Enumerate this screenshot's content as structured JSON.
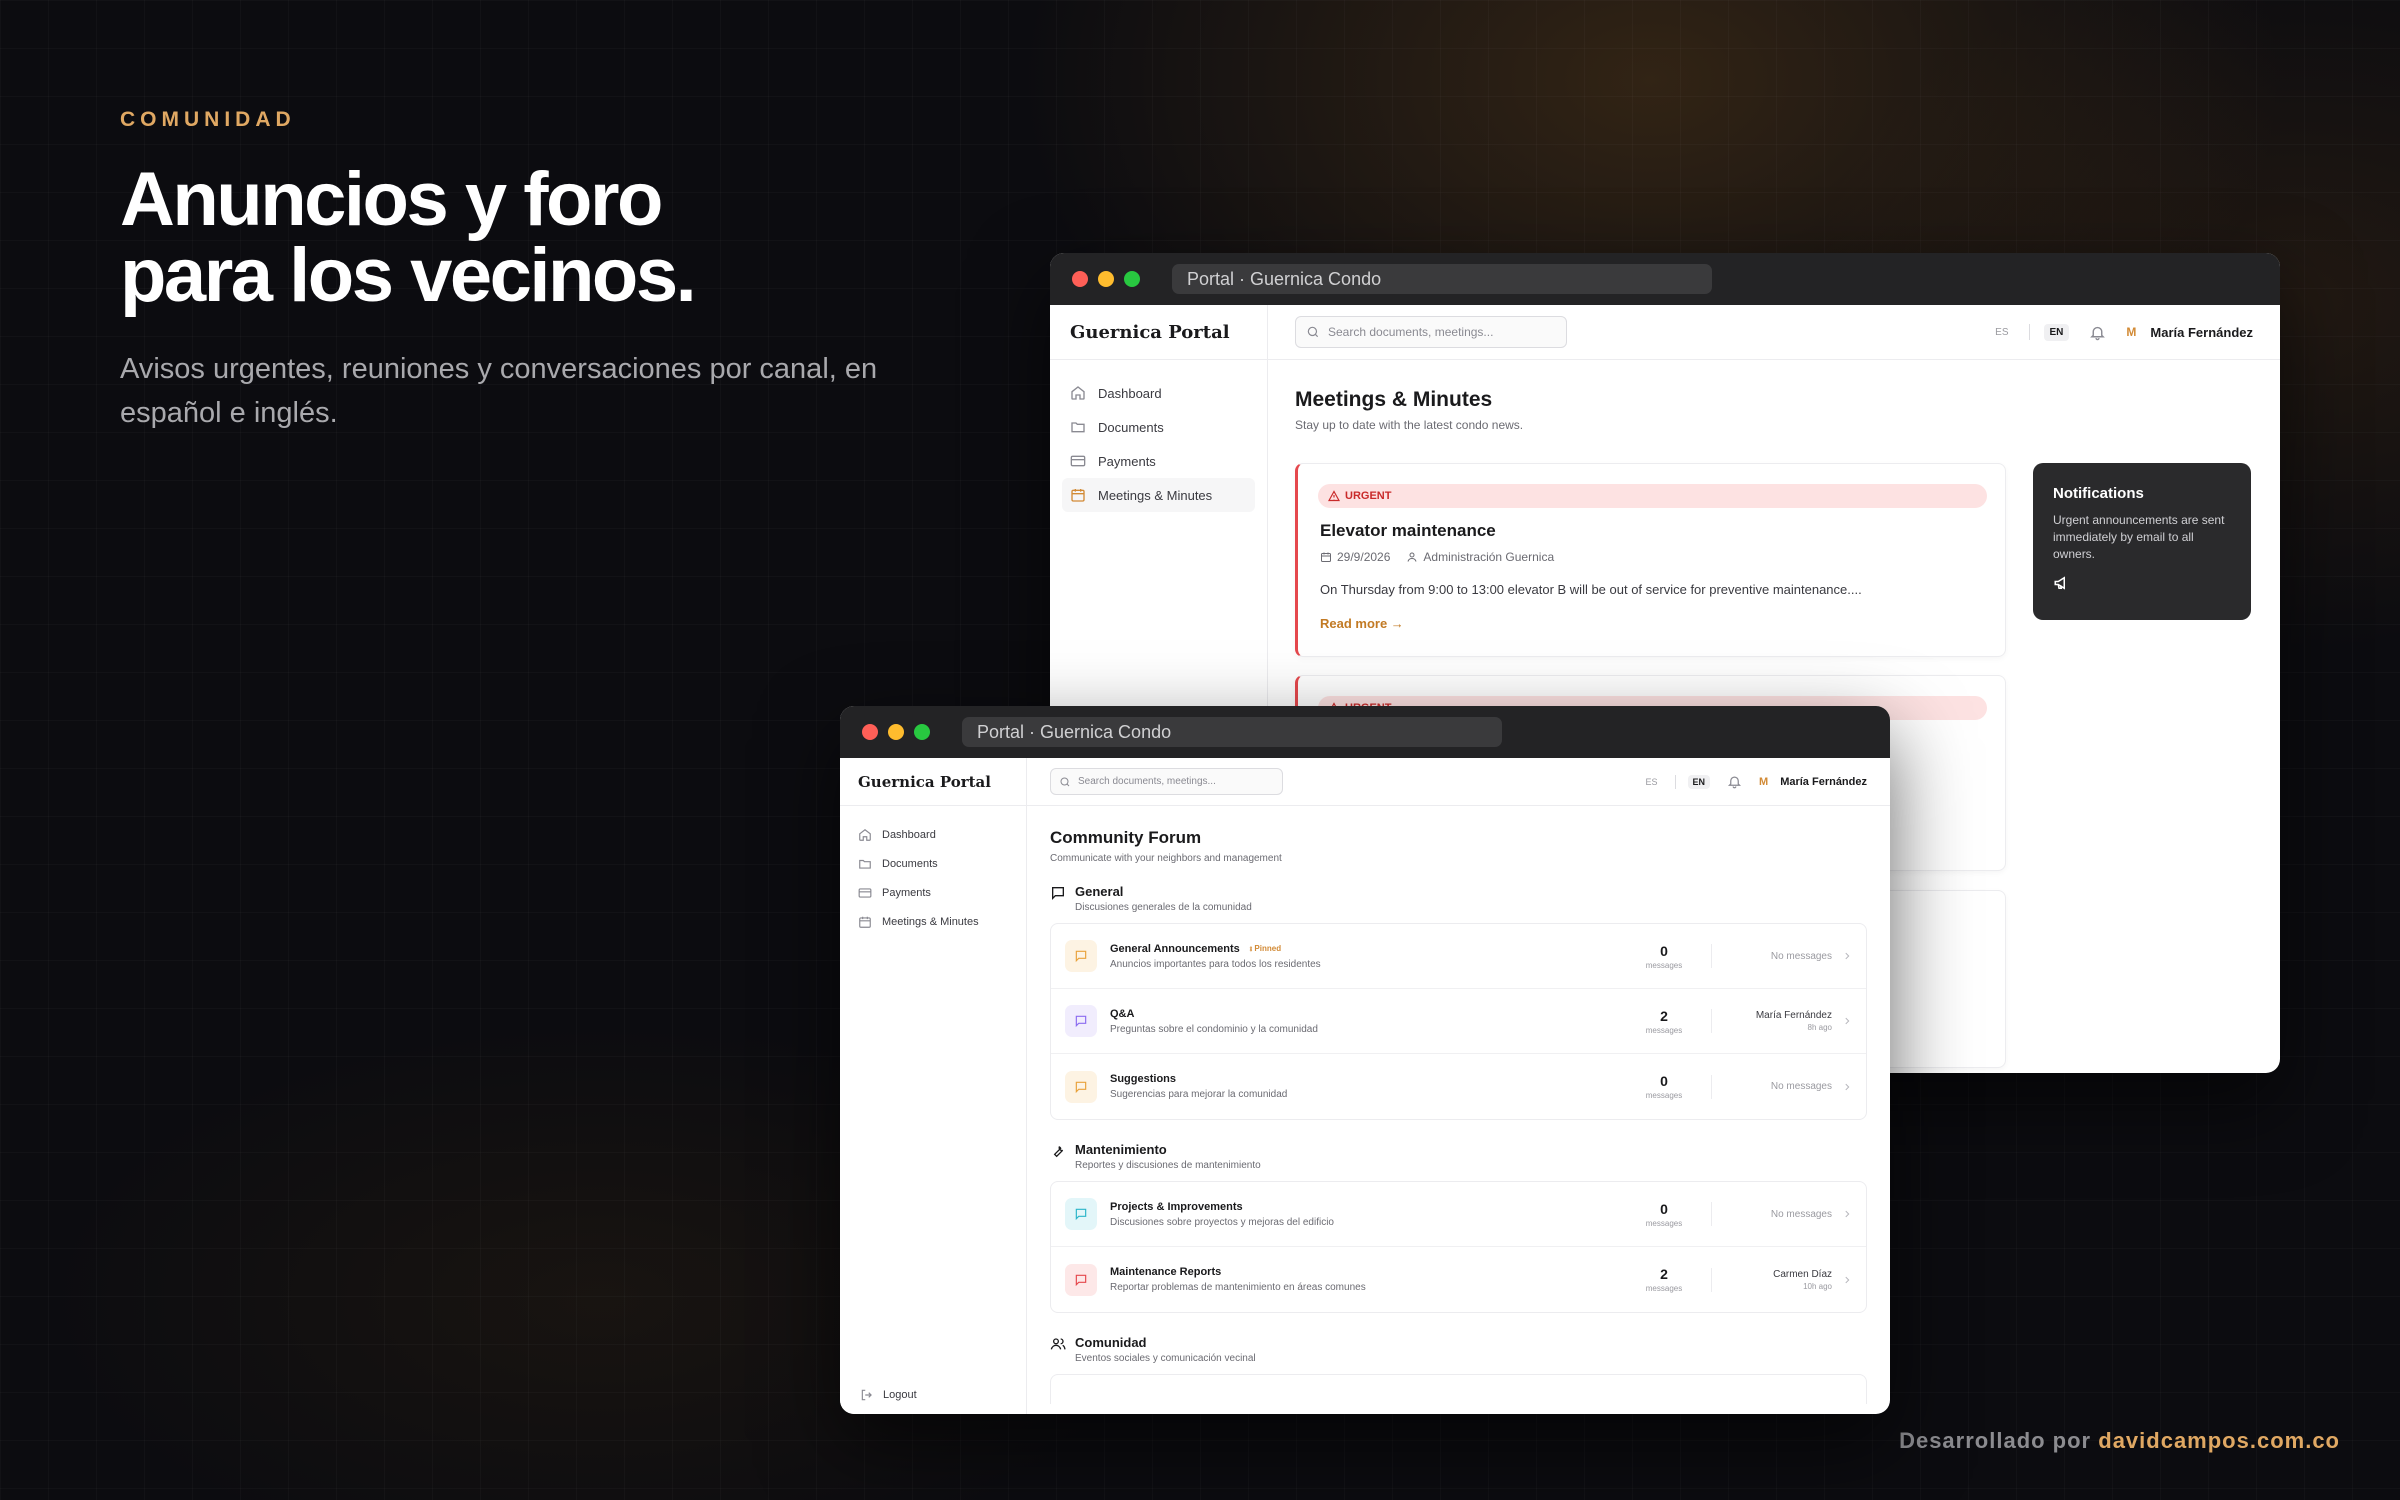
{
  "hero": {
    "eyebrow": "COMUNIDAD",
    "headline_line1": "Anuncios y foro",
    "headline_line2": "para los vecinos.",
    "subhead": "Avisos urgentes, reuniones y conversaciones por canal, en español e inglés."
  },
  "credit": {
    "prefix": "Desarrollado por",
    "link": "davidcampos.com.co"
  },
  "windowA": {
    "url": "Portal · Guernica Condo",
    "brand": "Guernica Portal",
    "nav": [
      {
        "label": "Dashboard",
        "icon": "home-icon"
      },
      {
        "label": "Documents",
        "icon": "folder-icon"
      },
      {
        "label": "Payments",
        "icon": "card-icon"
      },
      {
        "label": "Meetings & Minutes",
        "icon": "calendar-icon"
      }
    ],
    "search_placeholder": "Search documents, meetings...",
    "lang": {
      "es": "ES",
      "en": "EN"
    },
    "user_initial": "M",
    "user_name": "María Fernández",
    "page_title": "Meetings & Minutes",
    "page_sub": "Stay up to date with the latest condo news.",
    "announcement": {
      "badge": "URGENT",
      "title": "Elevator maintenance",
      "date": "29/9/2026",
      "author": "Administración Guernica",
      "body": "On Thursday from 9:00 to 13:00 elevator B will be out of service for preventive maintenance....",
      "read_more": "Read more →"
    },
    "announcement2_badge": "URGENT",
    "notifications": {
      "title": "Notifications",
      "body": "Urgent announcements are sent immediately by email to all owners."
    }
  },
  "windowB": {
    "url": "Portal · Guernica Condo",
    "brand": "Guernica Portal",
    "nav": [
      {
        "label": "Dashboard",
        "icon": "home-icon"
      },
      {
        "label": "Documents",
        "icon": "folder-icon"
      },
      {
        "label": "Payments",
        "icon": "card-icon"
      },
      {
        "label": "Meetings & Minutes",
        "icon": "calendar-icon"
      }
    ],
    "logout": "Logout",
    "search_placeholder": "Search documents, meetings...",
    "lang": {
      "es": "ES",
      "en": "EN"
    },
    "user_initial": "M",
    "user_name": "María Fernández",
    "page_title": "Community Forum",
    "page_sub": "Communicate with your neighbors and management",
    "categories": [
      {
        "name": "General",
        "desc": "Discusiones generales de la comunidad",
        "channels": [
          {
            "name": "General Announcements",
            "pinned": "Pinned",
            "desc": "Anuncios importantes para todos los residentes",
            "count": "0",
            "unit": "messages",
            "last": "No messages",
            "color": "#e9a23b",
            "tint": "#fdf3e3"
          },
          {
            "name": "Q&A",
            "desc": "Preguntas sobre el condominio y la comunidad",
            "count": "2",
            "unit": "messages",
            "last_name": "María Fernández",
            "last_time": "8h ago",
            "color": "#8b6cf0",
            "tint": "#f1edfd"
          },
          {
            "name": "Suggestions",
            "desc": "Sugerencias para mejorar la comunidad",
            "count": "0",
            "unit": "messages",
            "last": "No messages",
            "color": "#e9a23b",
            "tint": "#fdf3e3"
          }
        ]
      },
      {
        "name": "Mantenimiento",
        "desc": "Reportes y discusiones de mantenimiento",
        "channels": [
          {
            "name": "Projects & Improvements",
            "desc": "Discusiones sobre proyectos y mejoras del edificio",
            "count": "0",
            "unit": "messages",
            "last": "No messages",
            "color": "#2bb5c9",
            "tint": "#e3f6f9"
          },
          {
            "name": "Maintenance Reports",
            "desc": "Reportar problemas de mantenimiento en áreas comunes",
            "count": "2",
            "unit": "messages",
            "last_name": "Carmen Díaz",
            "last_time": "10h ago",
            "color": "#e5484d",
            "tint": "#fde8e8"
          }
        ]
      },
      {
        "name": "Comunidad",
        "desc": "Eventos sociales y comunicación vecinal",
        "channels": []
      }
    ]
  }
}
